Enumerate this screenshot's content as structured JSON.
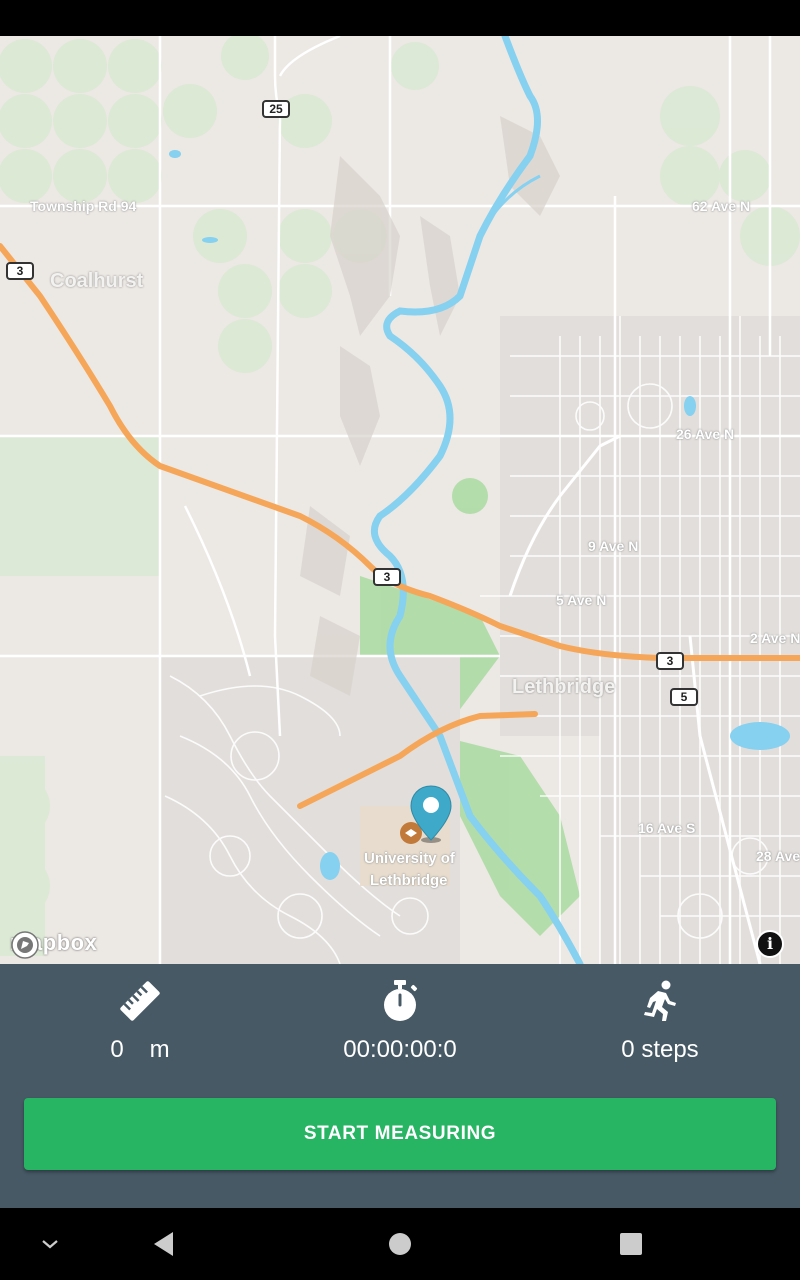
{
  "map": {
    "labels": {
      "coalhurst": "Coalhurst",
      "lethbridge": "Lethbridge",
      "university": "University of",
      "university2": "Lethbridge",
      "township": "Township Rd 94",
      "ave62": "62 Ave N",
      "ave26": "26 Ave N",
      "ave9": "9 Ave N",
      "ave5": "5 Ave N",
      "ave2": "2 Ave N",
      "ave16s": "16 Ave S",
      "ave28s": "28 Ave S",
      "st13": "13 St N",
      "st13s": "13 St S",
      "range": "Range Rd 2",
      "scenic": "Scenic Dr N"
    },
    "shields": {
      "hwy25": "25",
      "hwy3a": "3",
      "hwy3b": "3",
      "hwy3c": "3",
      "hwy5": "5"
    },
    "attribution": "mapbox",
    "info_icon": "info-icon"
  },
  "stats": {
    "distance_value": "0",
    "distance_unit": "m",
    "time": "00:00:00:0",
    "steps": "0 steps"
  },
  "actions": {
    "start_label": "START MEASURING"
  },
  "colors": {
    "panel": "#465965",
    "button": "#27b463",
    "pin": "#3fa9c9",
    "river": "#86d0f0",
    "highway": "#f5a658",
    "park": "#c8e6c0"
  }
}
